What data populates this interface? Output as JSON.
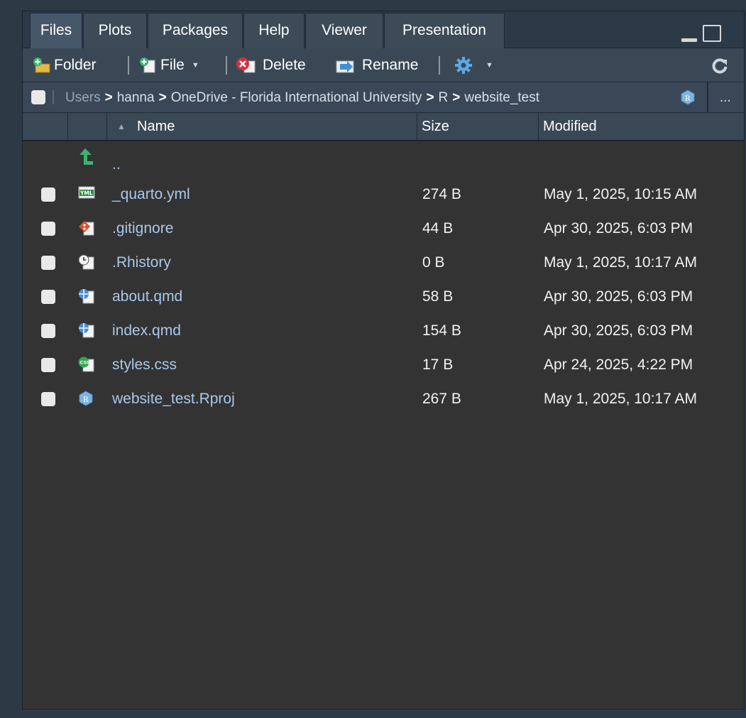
{
  "tabs": [
    "Files",
    "Plots",
    "Packages",
    "Help",
    "Viewer",
    "Presentation"
  ],
  "active_tab": "Files",
  "toolbar": {
    "folder_label": "Folder",
    "file_label": "File",
    "delete_label": "Delete",
    "rename_label": "Rename",
    "gear_icon": "gear-icon",
    "refresh_icon": "refresh-icon"
  },
  "breadcrumb": {
    "segments": [
      "Users",
      "hanna",
      "OneDrive - Florida International University",
      "R",
      "website_test"
    ],
    "more": "..."
  },
  "columns": {
    "name": "Name",
    "size": "Size",
    "modified": "Modified"
  },
  "parent_dir": "..",
  "files": [
    {
      "name": "_quarto.yml",
      "size": "274 B",
      "modified": "May 1, 2025, 10:15 AM",
      "icon": "yml-icon"
    },
    {
      "name": ".gitignore",
      "size": "44 B",
      "modified": "Apr 30, 2025, 6:03 PM",
      "icon": "git-icon"
    },
    {
      "name": ".Rhistory",
      "size": "0 B",
      "modified": "May 1, 2025, 10:17 AM",
      "icon": "history-icon"
    },
    {
      "name": "about.qmd",
      "size": "58 B",
      "modified": "Apr 30, 2025, 6:03 PM",
      "icon": "quarto-icon"
    },
    {
      "name": "index.qmd",
      "size": "154 B",
      "modified": "Apr 30, 2025, 6:03 PM",
      "icon": "quarto-icon"
    },
    {
      "name": "styles.css",
      "size": "17 B",
      "modified": "Apr 24, 2025, 4:22 PM",
      "icon": "css-icon"
    },
    {
      "name": "website_test.Rproj",
      "size": "267 B",
      "modified": "May 1, 2025, 10:17 AM",
      "icon": "rproj-icon"
    }
  ],
  "colors": {
    "accent_green": "#3cb371",
    "file_link": "#a9c8ea",
    "pane_bg": "#333333"
  }
}
